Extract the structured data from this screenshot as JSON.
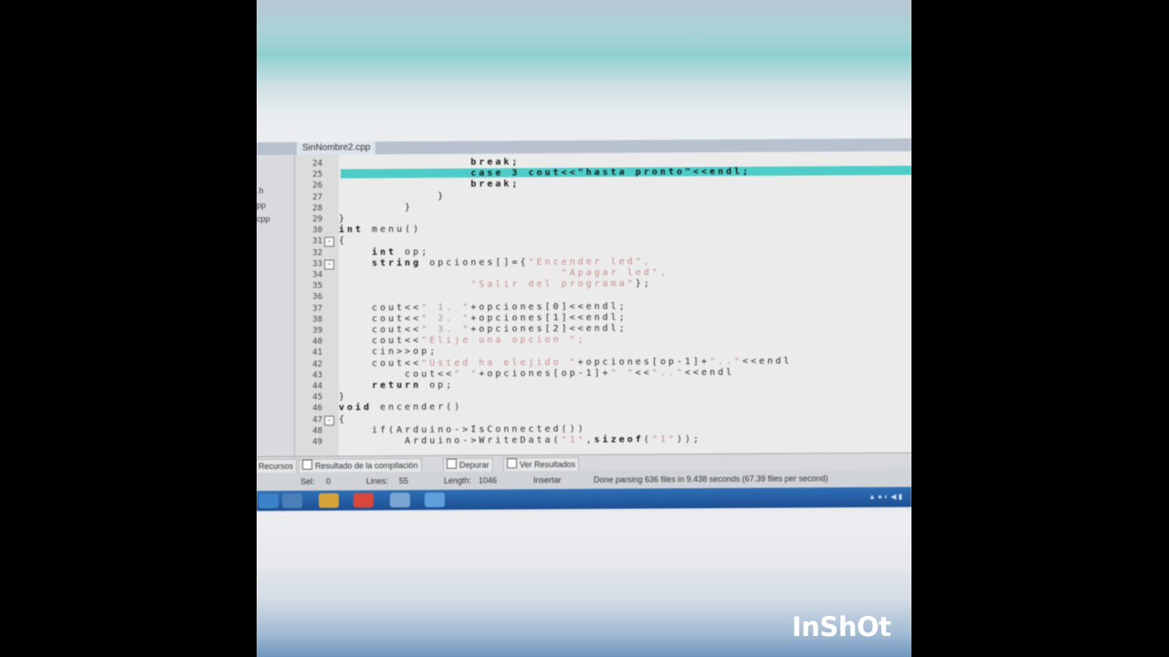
{
  "editor": {
    "tab_label": "SinNombre2.cpp",
    "class_items": [
      ".h",
      "pp",
      "cpp"
    ],
    "lines": [
      {
        "n": "24",
        "fold": "",
        "parts": [
          {
            "t": "                break;",
            "c": "kw"
          }
        ]
      },
      {
        "n": "25",
        "fold": "",
        "parts": [
          {
            "t": "                case 3 cout<<\"hasta pronto\"<<endl;",
            "c": "kw"
          }
        ]
      },
      {
        "n": "26",
        "fold": "",
        "parts": [
          {
            "t": "                break;",
            "c": "kw"
          }
        ]
      },
      {
        "n": "27",
        "fold": "",
        "parts": [
          {
            "t": "            }",
            "c": ""
          }
        ]
      },
      {
        "n": "28",
        "fold": "",
        "parts": [
          {
            "t": "        }",
            "c": ""
          }
        ]
      },
      {
        "n": "29",
        "fold": "",
        "parts": [
          {
            "t": "}",
            "c": ""
          }
        ]
      },
      {
        "n": "30",
        "fold": "",
        "parts": [
          {
            "t": "int",
            "c": "kw"
          },
          {
            "t": " menu()",
            "c": ""
          }
        ]
      },
      {
        "n": "31",
        "fold": "-",
        "parts": [
          {
            "t": "{",
            "c": ""
          }
        ]
      },
      {
        "n": "32",
        "fold": "",
        "parts": [
          {
            "t": "    int",
            "c": "kw"
          },
          {
            "t": " op;",
            "c": ""
          }
        ]
      },
      {
        "n": "33",
        "fold": "-",
        "parts": [
          {
            "t": "    string",
            "c": "kw"
          },
          {
            "t": " opciones[]={",
            "c": ""
          },
          {
            "t": "\"Encender led\",",
            "c": "str"
          }
        ]
      },
      {
        "n": "34",
        "fold": "",
        "parts": [
          {
            "t": "                           ",
            "c": ""
          },
          {
            "t": "\"Apagar led\",",
            "c": "str"
          }
        ]
      },
      {
        "n": "35",
        "fold": "",
        "parts": [
          {
            "t": "                ",
            "c": ""
          },
          {
            "t": "\"Salir del programa\"",
            "c": "str"
          },
          {
            "t": "};",
            "c": ""
          }
        ]
      },
      {
        "n": "36",
        "fold": "",
        "parts": [
          {
            "t": "",
            "c": ""
          }
        ]
      },
      {
        "n": "37",
        "fold": "",
        "parts": [
          {
            "t": "    cout<<",
            "c": ""
          },
          {
            "t": "\" 1. \"",
            "c": "dim"
          },
          {
            "t": "+opciones[0]<<endl;",
            "c": ""
          }
        ]
      },
      {
        "n": "38",
        "fold": "",
        "parts": [
          {
            "t": "    cout<<",
            "c": ""
          },
          {
            "t": "\" 2. \"",
            "c": "dim"
          },
          {
            "t": "+opciones[1]<<endl;",
            "c": ""
          }
        ]
      },
      {
        "n": "39",
        "fold": "",
        "parts": [
          {
            "t": "    cout<<",
            "c": ""
          },
          {
            "t": "\" 3. \"",
            "c": "dim"
          },
          {
            "t": "+opciones[2]<<endl;",
            "c": ""
          }
        ]
      },
      {
        "n": "40",
        "fold": "",
        "parts": [
          {
            "t": "    cout<<",
            "c": ""
          },
          {
            "t": "\"Elije una opcion \";",
            "c": "str"
          }
        ]
      },
      {
        "n": "41",
        "fold": "",
        "parts": [
          {
            "t": "    cin>>op;",
            "c": ""
          }
        ]
      },
      {
        "n": "42",
        "fold": "",
        "parts": [
          {
            "t": "    cout<<",
            "c": ""
          },
          {
            "t": "\"Usted ha elejido \"",
            "c": "str"
          },
          {
            "t": "+opciones[op-1]+",
            "c": ""
          },
          {
            "t": "\"..\"",
            "c": "str"
          },
          {
            "t": "<<endl",
            "c": ""
          }
        ]
      },
      {
        "n": "43",
        "fold": "",
        "parts": [
          {
            "t": "        cout<<",
            "c": ""
          },
          {
            "t": "\" \"",
            "c": "dim"
          },
          {
            "t": "+opciones[op-1]+",
            "c": ""
          },
          {
            "t": "\" \"",
            "c": "dim"
          },
          {
            "t": "<<",
            "c": ""
          },
          {
            "t": "\"..\"",
            "c": "dim"
          },
          {
            "t": "<<endl",
            "c": ""
          }
        ]
      },
      {
        "n": "44",
        "fold": "",
        "parts": [
          {
            "t": "    return",
            "c": "kw"
          },
          {
            "t": " op;",
            "c": ""
          }
        ]
      },
      {
        "n": "45",
        "fold": "",
        "parts": [
          {
            "t": "}",
            "c": ""
          }
        ]
      },
      {
        "n": "46",
        "fold": "",
        "parts": [
          {
            "t": "void",
            "c": "kw"
          },
          {
            "t": " encender()",
            "c": ""
          }
        ]
      },
      {
        "n": "47",
        "fold": "-",
        "parts": [
          {
            "t": "{",
            "c": ""
          }
        ]
      },
      {
        "n": "48",
        "fold": "",
        "parts": [
          {
            "t": "    if(Arduino->IsConnected())",
            "c": ""
          }
        ]
      },
      {
        "n": "49",
        "fold": "",
        "parts": [
          {
            "t": "        Arduino->WriteData(",
            "c": ""
          },
          {
            "t": "\"1\"",
            "c": "str"
          },
          {
            "t": ",",
            "c": ""
          },
          {
            "t": "sizeof",
            "c": "kw"
          },
          {
            "t": "(",
            "c": ""
          },
          {
            "t": "\"1\"",
            "c": "str"
          },
          {
            "t": "));",
            "c": ""
          }
        ]
      }
    ]
  },
  "bottom_tabs": {
    "recursos": "Recursos",
    "compilacion": "Resultado de la compilación",
    "depurar": "Depurar",
    "ver_resultados": "Ver Resultados"
  },
  "status": {
    "sel_label": "Sel:",
    "sel_value": "0",
    "lines_label": "Lines:",
    "lines_value": "55",
    "length_label": "Length:",
    "length_value": "1046",
    "mode": "Insertar",
    "message": "Done parsing 636 files in 9.438 seconds (67.39 files per second)"
  },
  "watermark": "InShOt",
  "colors": {
    "highlight": "#4ecdc8",
    "taskbar": "#2f6fb6"
  }
}
